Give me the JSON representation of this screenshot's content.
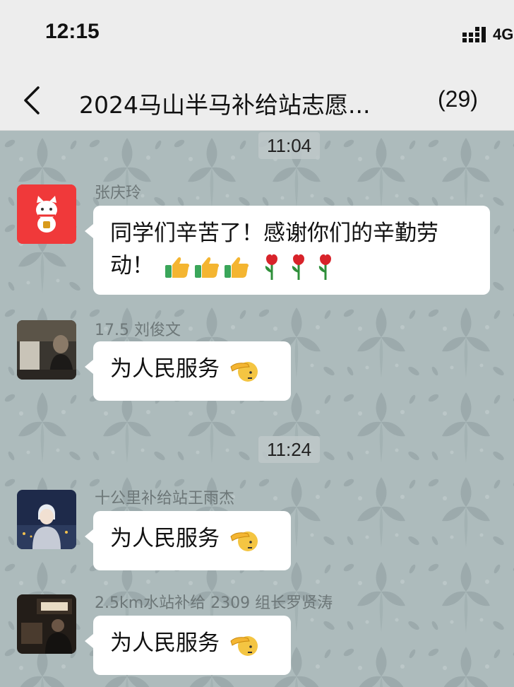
{
  "status_bar": {
    "time": "12:15",
    "network": "4G"
  },
  "header": {
    "title": "2024马山半马补给站志愿...",
    "member_count": "(29)"
  },
  "messages": [
    {
      "time_divider": "11:04",
      "sender": "张庆玲",
      "text": "同学们辛苦了！感谢你们的辛勤劳动！",
      "emojis": [
        "thumbs-up",
        "thumbs-up",
        "thumbs-up",
        "rose",
        "rose",
        "rose"
      ]
    },
    {
      "sender": "17.5 刘俊文",
      "text": "为人民服务",
      "emojis": [
        "salute"
      ]
    },
    {
      "time_divider": "11:24",
      "sender": "十公里补给站王雨杰",
      "text": "为人民服务",
      "emojis": [
        "salute"
      ]
    },
    {
      "sender": "2.5km水站补给 2309 组长罗贤涛",
      "text": "为人民服务",
      "emojis": [
        "salute"
      ]
    }
  ],
  "colors": {
    "header_bg": "#ededed",
    "bubble_bg": "#ffffff",
    "chat_bg": "#aab8b9",
    "avatar1_bg": "#f0393a"
  }
}
